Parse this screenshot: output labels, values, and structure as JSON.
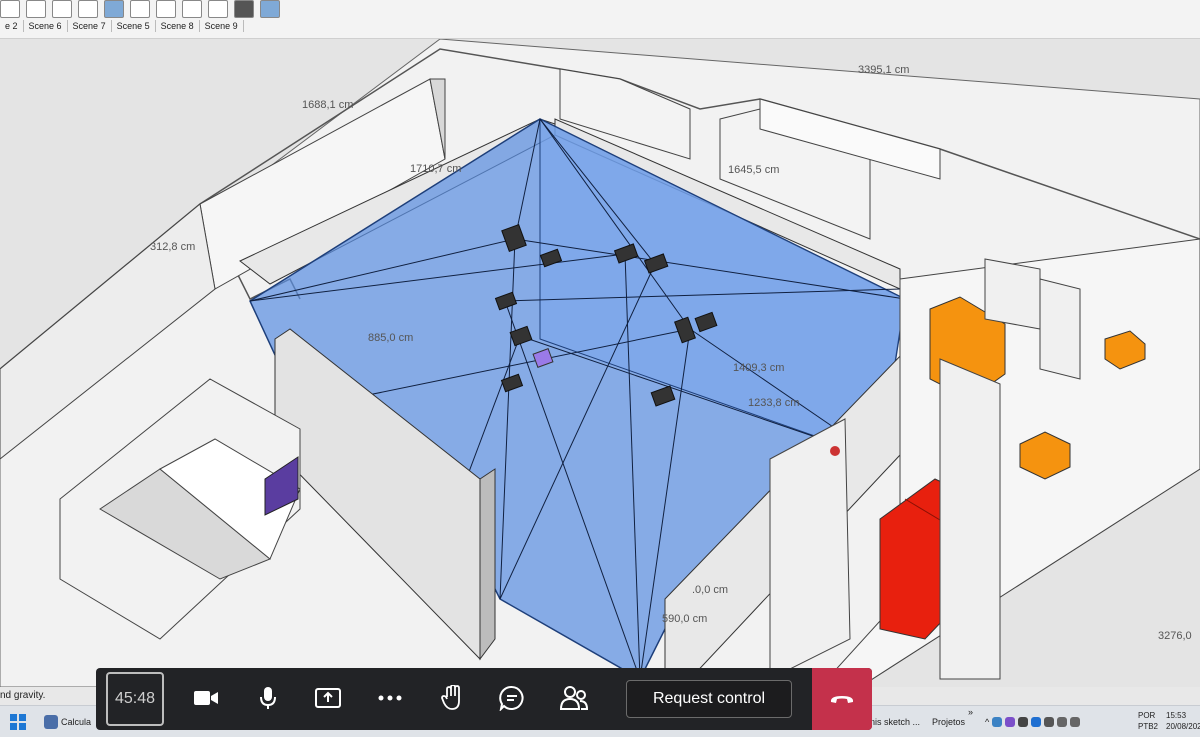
{
  "toolbar": {
    "scene_tabs": [
      "e 2",
      "Scene 6",
      "Scene 7",
      "Scene 5",
      "Scene 8",
      "Scene 9"
    ]
  },
  "dimensions": {
    "d1": "1688,1 cm",
    "d2": "1710,7 cm",
    "d3": "3395,1 cm",
    "d4": "1645,5 cm",
    "d5": "312,8 cm",
    "d6": "885,0 cm",
    "d7": "1409,3 cm",
    "d8": "1233,8 cm",
    "d9": ".0,0 cm",
    "d10": "590,0 cm",
    "d11": "3276,0"
  },
  "status": {
    "text": "nd gravity."
  },
  "meeting": {
    "timer": "45:48",
    "request_control": "Request control"
  },
  "taskbar": {
    "calc": "Calcula",
    "sketch": "nis sketch ...",
    "projetos": "Projetos",
    "chevrons": "»",
    "lang1": "POR",
    "lang2": "PTB2",
    "time": "15:53",
    "date": "20/08/202"
  },
  "colors": {
    "glass": "#5b8fe0",
    "orange": "#f5930f",
    "red": "#e8200e",
    "meeting_bg": "#222326",
    "hangup": "#c4314b"
  }
}
